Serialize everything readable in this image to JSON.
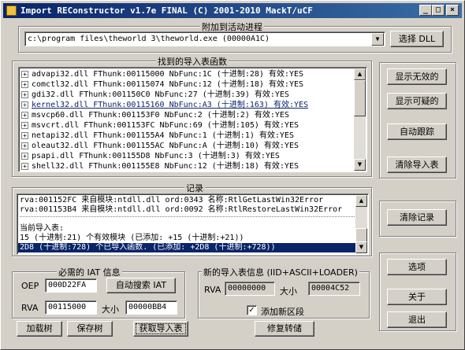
{
  "window": {
    "title": "Import REConstructor v1.7e FINAL (C) 2001-2010 MackT/uCF",
    "minimize": "_",
    "maximize": "□",
    "close": "×"
  },
  "attach": {
    "group_label": "附加到活动进程",
    "process_value": "c:\\program files\\theworld 3\\theworld.exe (00000A1C)",
    "select_dll": "选择 DLL"
  },
  "imports": {
    "group_label": "找到的导入表函数",
    "items": [
      "advapi32.dll FThunk:00115000 NbFunc:1C (十进制:28) 有效:YES",
      "comctl32.dll FThunk:00115074 NbFunc:12 (十进制:18) 有效:YES",
      "gdi32.dll FThunk:001150C0 NbFunc:27 (十进制:39) 有效:YES",
      "kernel32.dll FThunk:00115160 NbFunc:A3 (十进制:163) 有效:YES",
      "msvcp60.dll FThunk:001153F0 NbFunc:2 (十进制:2) 有效:YES",
      "msvcrt.dll FThunk:001153FC NbFunc:69 (十进制:105) 有效:YES",
      "netapi32.dll FThunk:001155A4 NbFunc:1 (十进制:1) 有效:YES",
      "oleaut32.dll FThunk:001155AC NbFunc:A (十进制:10) 有效:YES",
      "psapi.dll FThunk:001155D8 NbFunc:3 (十进制:3) 有效:YES",
      "shell32.dll FThunk:001155E8 NbFunc:12 (十进制:18) 有效:YES"
    ]
  },
  "right_buttons": {
    "show_invalid": "显示无效的",
    "show_suspect": "显示可疑的",
    "auto_trace": "自动跟踪",
    "clear_imports": "清除导入表",
    "clear_log": "清除记录",
    "options": "选项",
    "about": "关于",
    "exit": "退出"
  },
  "log": {
    "group_label": "记录",
    "lines": [
      "rva:001152FC 来自模块:ntdll.dll ord:0343 名称:RtlGetLastWin32Error",
      "rva:001153B4 来自模块:ntdll.dll ord:0092 名称:RtlRestoreLastWin32Error",
      "",
      "当前导入表:",
      "15 (十进制:21) 个有效模块 (已添加: +15 (十进制:+21))",
      "2D8 (十进制:728) 个已导入函数. (已添加: +2D8 (十进制:+728))"
    ]
  },
  "iat": {
    "group_label": "必需的 IAT 信息",
    "oep_label": "OEP",
    "oep_value": "000D22FA",
    "auto_search": "自动搜索 IAT",
    "rva_label": "RVA",
    "rva_value": "00115000",
    "size_label": "大小",
    "size_value": "00000BB4"
  },
  "new_import": {
    "group_label": "新的导入表信息 (IID+ASCII+LOADER)",
    "rva_label": "RVA",
    "rva_value": "00000000",
    "size_label": "大小",
    "size_value": "00004C52",
    "add_section_label": "添加新区段",
    "add_section_checked": "✓"
  },
  "bottom_buttons": {
    "load_tree": "加载树",
    "save_tree": "保存树",
    "get_imports": "获取导入表",
    "fix_dump": "修复转储"
  },
  "colors": {
    "title_start": "#0a246a",
    "title_end": "#3a6ea5",
    "selection": "#0a246a",
    "face": "#d4d0c8"
  }
}
